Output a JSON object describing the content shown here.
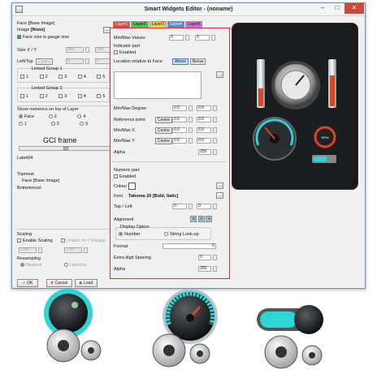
{
  "window": {
    "title": "Smart Widgets Editor - (noname)"
  },
  "left": {
    "face_label": "Face [Base Image]",
    "image_label": "Image",
    "image_value": "[None]",
    "gauge_size_label": "Face size is gauge size",
    "size_label": "Size X / Y",
    "size_x": "200",
    "size_y": "200",
    "lefttop_label": "Left/Top",
    "centre_label": "Centre",
    "left_value": "0",
    "top_value": "0",
    "linked1_label": "Linked Group 1",
    "linked2_label": "Linked Group 2",
    "n1": "1",
    "n2": "2",
    "n3": "3",
    "n4": "4",
    "n5": "5",
    "show_label": "Show numerics on top of Layer",
    "opt_face": "Face",
    "opt_2": "2",
    "opt_4": "4",
    "opt_1": "1",
    "opt_3": "3",
    "opt_5": "5",
    "gci_label": "GCI frame",
    "label04": "Label04",
    "topmost": "Topmost",
    "face_base": "Face [Base Image]",
    "bottommost": "Bottommost",
    "scaling_label": "Scaling",
    "enable_scaling": "Enable Scaling",
    "unlock_label": "Unlock X=Y linkage",
    "scale_x": "1.00",
    "scale_y": "1.00",
    "resampling_label": "Resampling",
    "nearest": "Nearest",
    "lanczos": "Lanczos",
    "ok": "OK",
    "cancel": "Cancel",
    "load": "Load"
  },
  "tabs": [
    "Layer1",
    "Layer2",
    "Layer3",
    "Layer4",
    "Layer5"
  ],
  "tab_colors": [
    "#e84040",
    "#4fc24f",
    "#f0d24a",
    "#5a86d8",
    "#d070d0"
  ],
  "middle": {
    "minmax_label": "Min/Max Values",
    "min_value": "0",
    "max_value": "0",
    "indicator_label": "Indicator part",
    "enabled_label": "Enabled",
    "location_label": "Location relative to Face",
    "above": "Above",
    "below": "Below",
    "degree_label": "Min/Max Degree",
    "degree_min": "0.0",
    "degree_max": "0.0",
    "refpoint_label": "Reference point",
    "centre": "Centre",
    "ref_x": "0.0",
    "ref_y": "0.0",
    "minmax_x_label": "Min/Max X",
    "mmx_a": "0.0",
    "mmx_b": "0.0",
    "minmax_y_label": "Min/Max Y",
    "mmy_a": "0.0",
    "mmy_b": "0.0",
    "alpha_label": "Alpha",
    "alpha_value": "255",
    "numeric_label": "Numeric part",
    "numeric_enabled": "Enabled",
    "colour_label": "Colour",
    "font_label": "Font",
    "font_value": "Tahoma 20 [Bold, Italic]",
    "topleft_label": "Top / Left",
    "tl_a": "0",
    "tl_b": "0",
    "alignment_label": "Alignment",
    "display_label": "Display Option",
    "number_opt": "Number",
    "string_opt": "String Look-up",
    "format_label": "Format",
    "format_value": "0",
    "extra_label": "Extra digit Spacing",
    "extra_value": "0",
    "alpha2_label": "Alpha",
    "alpha2_value": "255"
  },
  "preview": {
    "rpm_label": "RPM"
  },
  "colors": {
    "accent": "#2fd4d4",
    "frame": "#d2343d",
    "panel": "#171a1c"
  }
}
